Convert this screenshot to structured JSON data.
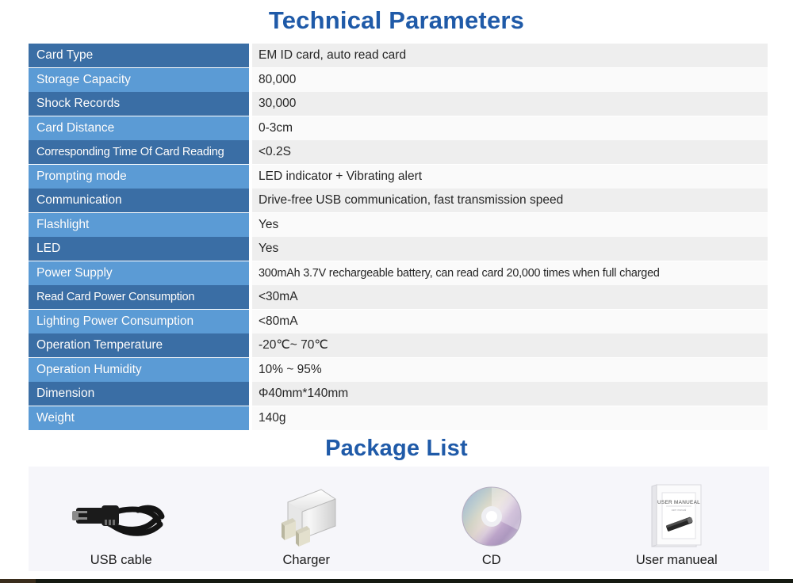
{
  "sections": {
    "tech_title": "Technical Parameters",
    "package_title": "Package List"
  },
  "spec_table": {
    "rows": [
      {
        "label": "Card Type",
        "value": "EM ID card, auto read card"
      },
      {
        "label": "Storage Capacity",
        "value": "80,000"
      },
      {
        "label": "Shock Records",
        "value": "30,000"
      },
      {
        "label": "Card Distance",
        "value": "0-3cm"
      },
      {
        "label": "Corresponding Time Of Card Reading",
        "value": "<0.2S"
      },
      {
        "label": "Prompting mode",
        "value": "LED indicator + Vibrating alert"
      },
      {
        "label": "Communication",
        "value": "Drive-free USB communication, fast transmission speed"
      },
      {
        "label": "Flashlight",
        "value": "Yes"
      },
      {
        "label": "LED",
        "value": "Yes"
      },
      {
        "label": "Power Supply",
        "value": "300mAh 3.7V rechargeable battery, can read card 20,000 times when full charged"
      },
      {
        "label": "Read Card Power Consumption",
        "value": "<30mA"
      },
      {
        "label": "Lighting Power Consumption",
        "value": "<80mA"
      },
      {
        "label": "Operation Temperature",
        "value": "-20℃~ 70℃"
      },
      {
        "label": "Operation Humidity",
        "value": "10% ~ 95%"
      },
      {
        "label": "Dimension",
        "value": "Φ40mm*140mm"
      },
      {
        "label": "Weight",
        "value": "140g"
      }
    ]
  },
  "package_list": {
    "items": [
      {
        "caption": "USB cable",
        "icon": "usb-cable-icon"
      },
      {
        "caption": "Charger",
        "icon": "charger-icon"
      },
      {
        "caption": "CD",
        "icon": "cd-disc-icon"
      },
      {
        "caption": "User manueal",
        "icon": "user-manual-icon"
      }
    ]
  },
  "manual_cover": {
    "title": "USER MANUEAL",
    "subtitle": "user manual"
  },
  "colors": {
    "heading_blue": "#1f5aa8",
    "label_dark_blue": "#3a6ea5",
    "label_light_blue": "#5b9bd5",
    "value_shade": "#eeeeee",
    "value_plain": "#fafafa",
    "panel_bg": "#f6f6fa"
  }
}
